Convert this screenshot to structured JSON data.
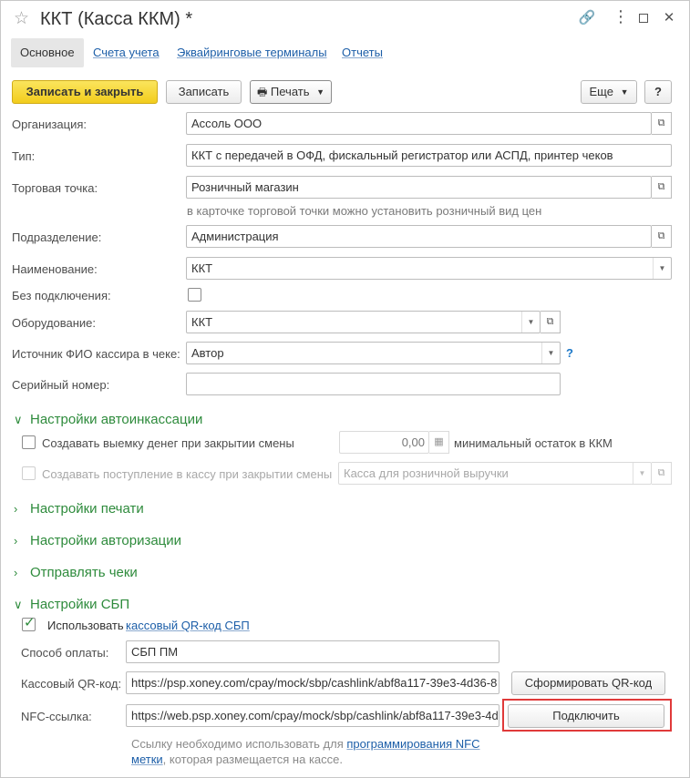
{
  "window": {
    "title": "ККТ (Касса ККМ) *",
    "star_icon": "star-icon",
    "link_icon": "link-icon",
    "more_icon": "more-icon",
    "maximize_icon": "maximize-icon",
    "close_icon": "close-icon"
  },
  "tabs": [
    {
      "label": "Основное"
    },
    {
      "label": "Счета учета"
    },
    {
      "label": "Эквайринговые терминалы"
    },
    {
      "label": "Отчеты"
    }
  ],
  "toolbar": {
    "save_close": "Записать и закрыть",
    "save": "Записать",
    "print": "Печать",
    "more": "Еще",
    "help": "?"
  },
  "form": {
    "organization": {
      "label": "Организация:",
      "value": "Ассоль ООО"
    },
    "type": {
      "label": "Тип:",
      "value": "ККТ с передачей в ОФД, фискальный регистратор или АСПД, принтер чеков"
    },
    "store": {
      "label": "Торговая точка:",
      "value": "Розничный магазин",
      "hint": "в карточке торговой точки можно установить розничный вид цен"
    },
    "department": {
      "label": "Подразделение:",
      "value": "Администрация"
    },
    "name": {
      "label": "Наименование:",
      "value": "ККТ"
    },
    "no_connection": {
      "label": "Без подключения:",
      "checked": false
    },
    "equipment": {
      "label": "Оборудование:",
      "value": "ККТ"
    },
    "cashier_source": {
      "label": "Источник ФИО кассира в чеке:",
      "value": "Автор",
      "help": "?"
    },
    "serial": {
      "label": "Серийный номер:",
      "value": ""
    }
  },
  "sections": {
    "auto_collection": {
      "title": "Настройки автоинкассации",
      "create_withdrawal": {
        "label": "Создавать выемку денег при закрытии смены",
        "checked": false
      },
      "amount": "0,00",
      "min_balance_label": "минимальный остаток в ККМ",
      "create_receipt": {
        "label": "Создавать поступление в кассу при закрытии смены",
        "checked": false
      },
      "cashbox_placeholder": "Касса для розничной выручки"
    },
    "print": {
      "title": "Настройки печати"
    },
    "auth": {
      "title": "Настройки авторизации"
    },
    "send_receipts": {
      "title": "Отправлять чеки"
    },
    "sbp": {
      "title": "Настройки СБП",
      "use": {
        "label": "Использовать",
        "link": "кассовый QR-код СБП",
        "checked": true
      },
      "payment_method": {
        "label": "Способ оплаты:",
        "value": "СБП ПМ"
      },
      "qr": {
        "label": "Кассовый QR-код:",
        "value": "https://psp.xoney.com/cpay/mock/sbp/cashlink/abf8a117-39e3-4d36-8",
        "button": "Сформировать QR-код"
      },
      "nfc": {
        "label": "NFC-ссылка:",
        "value": "https://web.psp.xoney.com/cpay/mock/sbp/cashlink/abf8a117-39e3-4d",
        "button": "Подключить"
      },
      "note_prefix": "Ссылку необходимо использовать для",
      "note_link_1": "программирования NFC",
      "note_link_2": "метки",
      "note_suffix": ", которая размещается на кассе."
    }
  },
  "colors": {
    "section": "#2e8b3c",
    "link": "#1c5ea8",
    "primary_button": "#f2cd1c",
    "highlight": "#e03a3a"
  }
}
